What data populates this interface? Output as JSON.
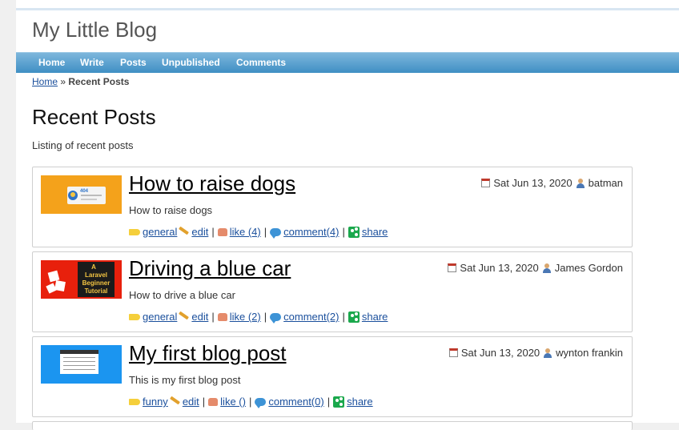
{
  "site": {
    "title": "My Little Blog"
  },
  "nav": [
    {
      "label": "Home"
    },
    {
      "label": "Write"
    },
    {
      "label": "Posts"
    },
    {
      "label": "Unpublished"
    },
    {
      "label": "Comments"
    }
  ],
  "breadcrumb": {
    "home": "Home",
    "separator": "»",
    "current": "Recent Posts"
  },
  "page": {
    "title": "Recent Posts",
    "subtitle": "Listing of recent posts"
  },
  "posts": [
    {
      "title": "How to raise dogs",
      "description": "How to raise dogs",
      "date": "Sat Jun 13, 2020",
      "author": "batman",
      "category": " general",
      "edit": " edit",
      "like": " like (4)",
      "comment": " comment(4)",
      "share": " share",
      "thumb_text": "404"
    },
    {
      "title": "Driving a blue car",
      "description": "How to drive a blue car",
      "date": "Sat Jun 13, 2020",
      "author": "James Gordon",
      "category": " general",
      "edit": " edit",
      "like": " like (2)",
      "comment": " comment(2)",
      "share": " share",
      "thumb_lines": [
        "A",
        "Laravel",
        "Beginner",
        "Tutorial"
      ]
    },
    {
      "title": "My first blog post",
      "description": "This is my first blog post",
      "date": "Sat Jun 13, 2020",
      "author": "wynton frankin",
      "category": " funny ",
      "edit": " edit",
      "like": " like ()",
      "comment": " comment(0)",
      "share": " share"
    }
  ],
  "colors": {
    "nav_top": "#7db7dc",
    "nav_bottom": "#3f8fc4",
    "link": "#1a4f9c"
  }
}
